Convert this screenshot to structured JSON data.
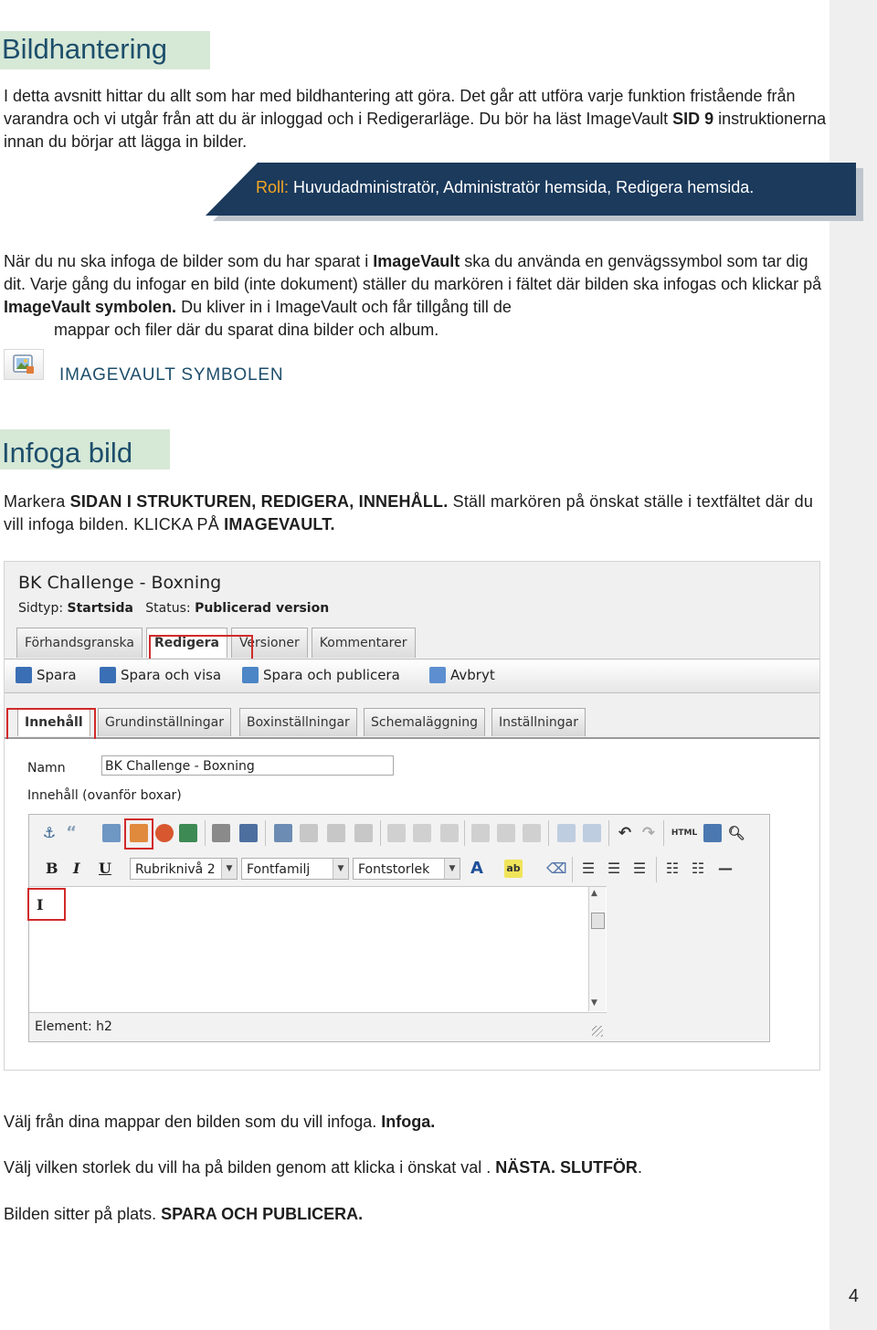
{
  "page_number": "4",
  "section1": {
    "title": "Bildhantering",
    "intro": [
      {
        "t": "I detta avsnitt hittar du allt som har med bildhantering att göra. Det går att utföra varje funktion fristående från varandra och vi utgår från att du är inloggad och i Redigerarläge. Du bör ha läst ImageVault "
      },
      {
        "t": "SID 9",
        "b": true
      },
      {
        "t": " instruktionerna innan du börjar att lägga in bilder."
      }
    ],
    "role_label": "Roll:",
    "role_text": " Huvudadministratör, Administratör hemsida, Redigera hemsida.",
    "body": [
      {
        "t": "När du nu ska infoga de bilder som du har sparat i "
      },
      {
        "t": "ImageVault",
        "b": true
      },
      {
        "t": " ska du använda en genvägssymbol som tar dig dit. Varje gång du infogar en bild (inte dokument) ställer du markören i fältet där bilden ska infogas och klickar på "
      },
      {
        "t": "ImageVault symbolen.",
        "b": true
      },
      {
        "t": " Du kliver in i ImageVault och får tillgång till de"
      }
    ],
    "body_indent": "mappar och filer där du sparat dina bilder och album.",
    "icon_caption": "IMAGEVAULT SYMBOLEN"
  },
  "section2": {
    "title": "Infoga bild",
    "intro": [
      {
        "t": "Markera "
      },
      {
        "t": "SIDAN I STRUKTUREN, REDIGERA, INNEHÅLL.",
        "b": true
      },
      {
        "t": " Ställ markören på önskat ställe i textfältet där du vill infoga bilden. "
      },
      {
        "t": "KLICKA PÅ ",
        "c": true
      },
      {
        "t": "IMAGEVAULT.",
        "b": true
      }
    ],
    "step1": [
      {
        "t": "Välj från dina mappar den bilden som du vill infoga. "
      },
      {
        "t": "Infoga.",
        "b": true
      }
    ],
    "step2": [
      {
        "t": "Välj vilken storlek du vill ha på bilden genom att klicka i önskat val . "
      },
      {
        "t": "NÄSTA. SLUTFÖR",
        "b": true
      },
      {
        "t": "."
      }
    ],
    "step3": [
      {
        "t": "Bilden sitter på plats. "
      },
      {
        "t": "SPARA OCH PUBLICERA.",
        "b": true
      }
    ]
  },
  "screenshot": {
    "page_title": "BK Challenge - Boxning",
    "meta_type_label": "Sidtyp:",
    "meta_type_value": "Startsida",
    "meta_status_label": "Status:",
    "meta_status_value": "Publicerad version",
    "main_tabs": [
      "Förhandsgranska",
      "Redigera",
      "Versioner",
      "Kommentarer"
    ],
    "actions": [
      "Spara",
      "Spara och visa",
      "Spara och publicera",
      "Avbryt"
    ],
    "content_tabs": [
      "Innehåll",
      "Grundinställningar",
      "Boxinställningar",
      "Schemaläggning",
      "Inställningar"
    ],
    "name_label": "Namn",
    "name_value": "BK Challenge - Boxning",
    "content_label": "Innehåll (ovanför boxar)",
    "format_buttons": [
      "B",
      "I",
      "U"
    ],
    "dropdowns": [
      "Rubriknivå 2",
      "Fontfamilj",
      "Fontstorlek"
    ],
    "html_label": "HTML",
    "editor_cursor": "I",
    "status_element": "Element: h2"
  },
  "colors": {
    "heading_bg": "#d6e8d6",
    "heading_text": "#1d4e6b",
    "role_band": "#1b3a5c",
    "role_label": "#f5a623",
    "highlight": "#d12a2a"
  }
}
